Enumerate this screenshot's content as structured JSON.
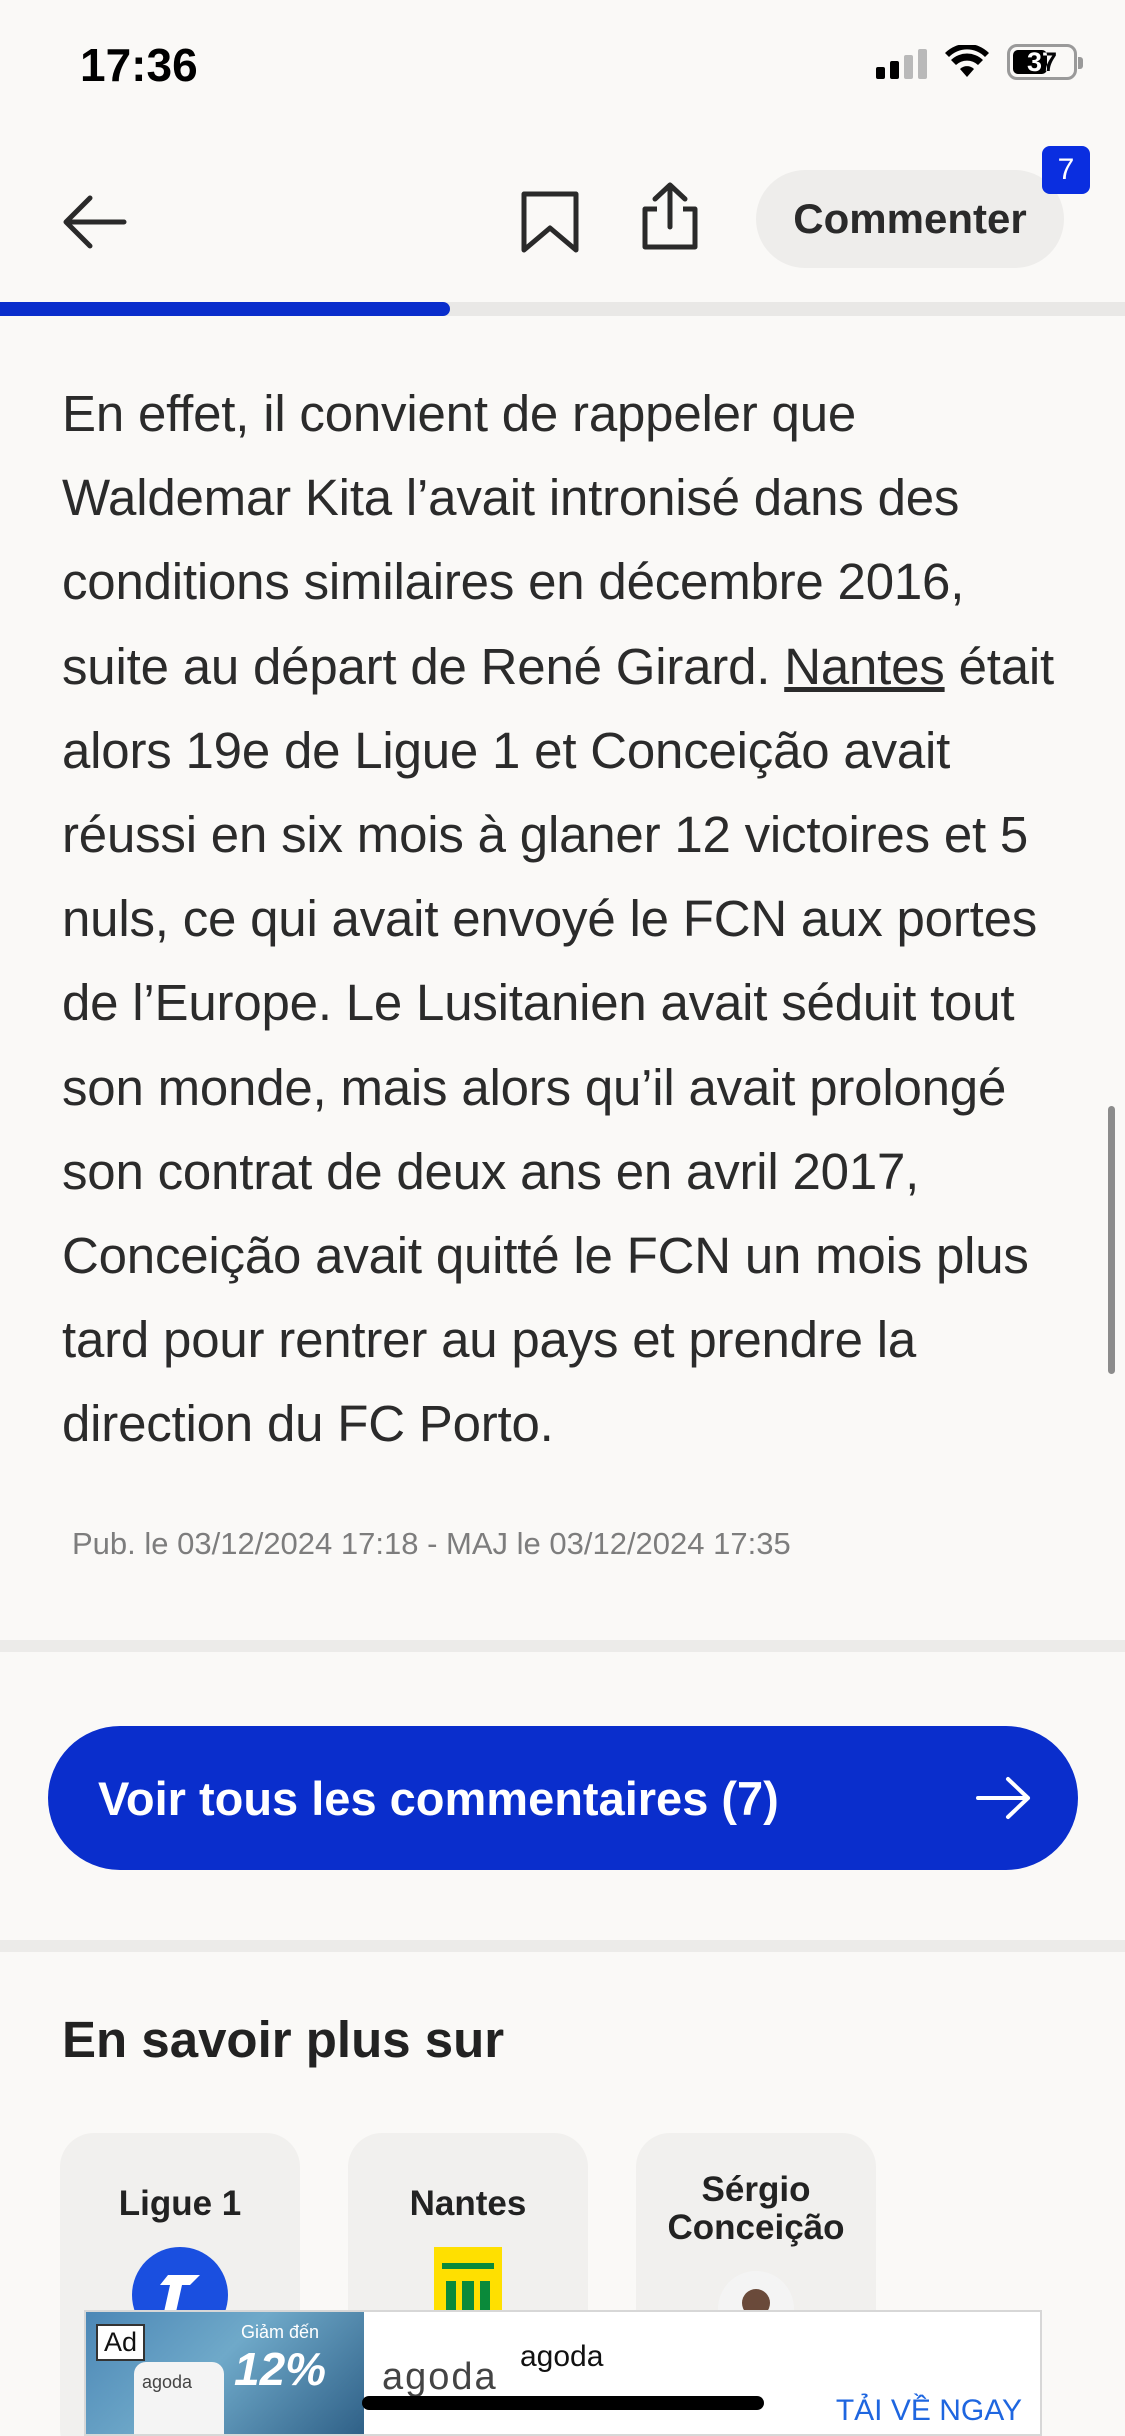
{
  "status_bar": {
    "time": "17:36",
    "battery": "37"
  },
  "nav": {
    "comment_label": "Commenter",
    "comment_count": "7",
    "reading_progress": 0.4
  },
  "article": {
    "p_before_link": "En effet, il convient de rappeler que Waldemar Kita l’avait intronisé dans des conditions similaires en décembre 2016, suite au départ de René Girard. ",
    "link_text": "Nantes",
    "p_after_link": " était alors 19e de Ligue 1 et Conceição avait réussi en six mois à glaner 12 victoires et 5 nuls, ce qui avait envoyé le FCN aux portes de l’Europe. Le Lusitanien avait séduit tout son monde, mais alors qu’il avait prolongé son contrat de deux ans en avril 2017, Conceição avait quitté le FCN un mois plus tard pour rentrer au pays et prendre la direction du FC Porto.",
    "pub_info": "Pub. le 03/12/2024 17:18 - MAJ le 03/12/2024 17:35"
  },
  "comments_button": {
    "label": "Voir tous les commentaires (7)"
  },
  "related": {
    "title": "En savoir plus sur",
    "topics": [
      {
        "name": "Ligue 1"
      },
      {
        "name": "Nantes"
      },
      {
        "name": "Sérgio Conceição"
      }
    ]
  },
  "ad": {
    "label": "Ad",
    "promo_small": "Giảm đến",
    "promo_big": "12%",
    "phone_logo": "agoda",
    "brand_big": "agoda",
    "brand_name": "agoda",
    "cta": "TẢI VỀ NGAY"
  },
  "colors": {
    "accent": "#0a2ecc",
    "background": "#faf9f7"
  }
}
